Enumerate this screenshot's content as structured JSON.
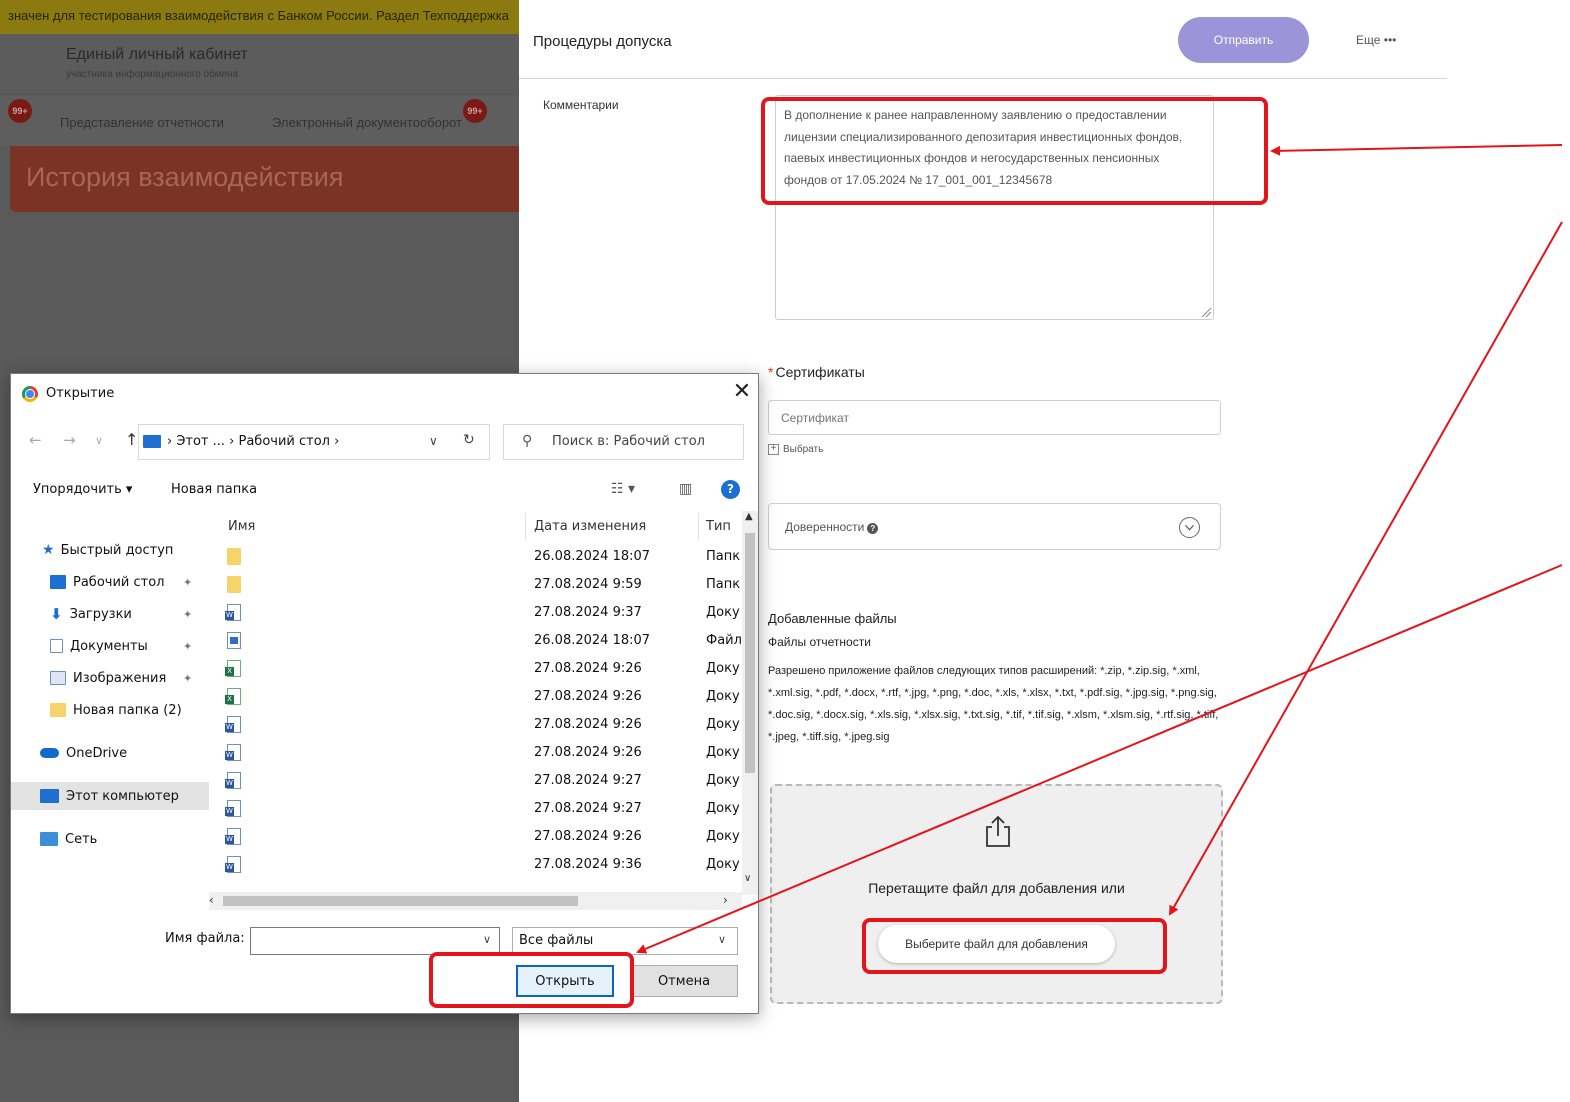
{
  "background_portal": {
    "banner_text": "значен для тестирования взаимодействия с Банком России. Раздел Техподдержка",
    "header_title": "Единый личный кабинет",
    "header_subtitle": "участника информационного обмена",
    "nav": [
      {
        "label": "Представление отчетности",
        "badge": "99+"
      },
      {
        "label": "Электронный документооборот",
        "badge": "99+"
      }
    ],
    "hero_title": "История взаимодействия"
  },
  "form": {
    "title": "Процедуры допуска",
    "send_label": "Отправить",
    "more_label": "Еще •••",
    "comment_label": "Комментарии",
    "comment_value": "В дополнение к ранее направленному заявлению о предоставлении лицензии специализированного депозитария инвестиционных фондов, паевых инвестиционных фондов и негосударственных пенсионных фондов от 17.05.2024 № 17_001_001_12345678",
    "certificates_label": "Сертификаты",
    "certificate_placeholder": "Сертификат",
    "choose_label": "Выбрать",
    "powers_label": "Доверенности",
    "added_files_title": "Добавленные файлы",
    "report_files_label": "Файлы отчетности",
    "allowed_types_text": "Разрешено приложение файлов следующих типов расширений: *.zip, *.zip.sig, *.xml, *.xml.sig, *.pdf, *.docx, *.rtf, *.jpg, *.png, *.doc, *.xls, *.xlsx, *.txt, *.pdf.sig, *.jpg.sig, *.png.sig, *.doc.sig, *.docx.sig, *.xls.sig, *.xlsx.sig, *.txt.sig, *.tif, *.tif.sig, *.xlsm, *.xlsm.sig, *.rtf.sig, *.tiff, *.jpeg, *.tiff.sig, *.jpeg.sig",
    "dropzone_text": "Перетащите файл для добавления или",
    "dropzone_button": "Выберите файл для добавления"
  },
  "dialog": {
    "title": "Открытие",
    "path": "› Этот ... › Рабочий стол ›",
    "search_placeholder": "Поиск в: Рабочий стол",
    "toolbar": {
      "organize": "Упорядочить ▾",
      "new_folder": "Новая папка"
    },
    "nav_pane": [
      {
        "label": "Быстрый доступ",
        "icon": "star-icon"
      },
      {
        "label": "Рабочий стол",
        "icon": "desktop-icon"
      },
      {
        "label": "Загрузки",
        "icon": "download-icon"
      },
      {
        "label": "Документы",
        "icon": "documents-icon"
      },
      {
        "label": "Изображения",
        "icon": "images-icon"
      },
      {
        "label": "Новая папка (2)",
        "icon": "folder-icon"
      },
      {
        "label": "OneDrive",
        "icon": "cloud-icon"
      },
      {
        "label": "Этот компьютер",
        "icon": "computer-icon",
        "selected": true
      },
      {
        "label": "Сеть",
        "icon": "network-icon"
      }
    ],
    "columns": {
      "name": "Имя",
      "date": "Дата изменения",
      "type": "Тип"
    },
    "files": [
      {
        "icon": "folder",
        "date": "26.08.2024 18:07",
        "type": "Папк"
      },
      {
        "icon": "folder",
        "date": "27.08.2024 9:59",
        "type": "Папк"
      },
      {
        "icon": "doc",
        "date": "27.08.2024 9:37",
        "type": "Доку"
      },
      {
        "icon": "img",
        "date": "26.08.2024 18:07",
        "type": "Файл"
      },
      {
        "icon": "xls",
        "date": "27.08.2024 9:26",
        "type": "Доку"
      },
      {
        "icon": "xls",
        "date": "27.08.2024 9:26",
        "type": "Доку"
      },
      {
        "icon": "doc",
        "date": "27.08.2024 9:26",
        "type": "Доку"
      },
      {
        "icon": "doc",
        "date": "27.08.2024 9:26",
        "type": "Доку"
      },
      {
        "icon": "doc",
        "date": "27.08.2024 9:27",
        "type": "Доку"
      },
      {
        "icon": "doc",
        "date": "27.08.2024 9:27",
        "type": "Доку"
      },
      {
        "icon": "doc",
        "date": "27.08.2024 9:26",
        "type": "Доку"
      },
      {
        "icon": "doc",
        "date": "27.08.2024 9:36",
        "type": "Доку"
      }
    ],
    "filename_label": "Имя файла:",
    "filename_value": "",
    "filetype_value": "Все файлы",
    "open_label": "Открыть",
    "cancel_label": "Отмена"
  },
  "annotation_color": "#e3151a"
}
